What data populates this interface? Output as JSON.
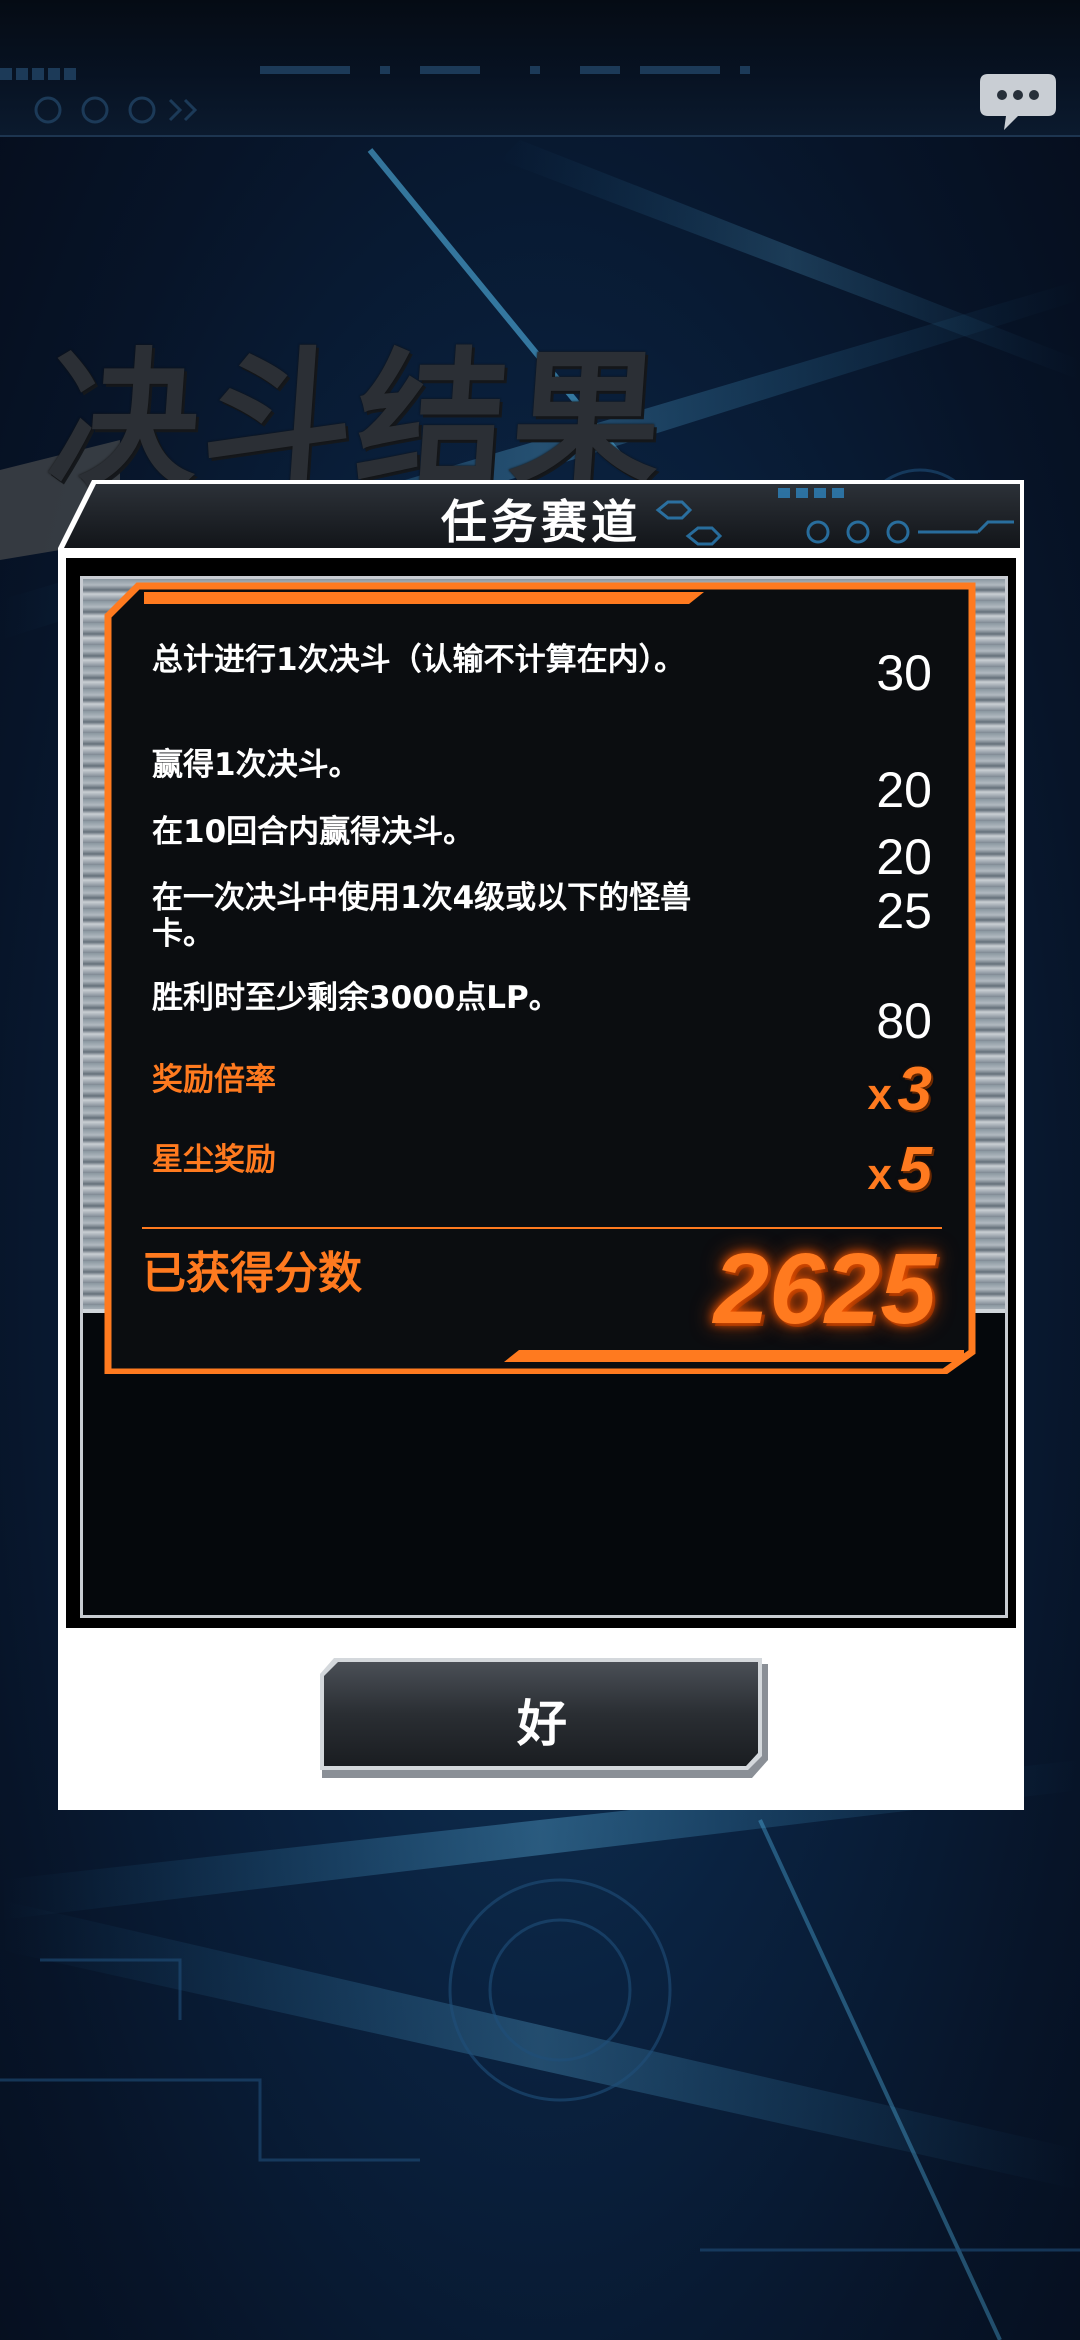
{
  "background": {
    "title": "决斗结果"
  },
  "dialog": {
    "title": "任务赛道",
    "missions": [
      {
        "label": "总计进行1次决斗（认输不计算在内）。",
        "value": "30"
      },
      {
        "label": "赢得1次决斗。",
        "value": "20"
      },
      {
        "label": "在10回合内赢得决斗。",
        "value": "20"
      },
      {
        "label": "在一次决斗中使用1次4级或以下的怪兽卡。",
        "value": "25"
      },
      {
        "label": "胜利时至少剩余3000点LP。",
        "value": "80"
      }
    ],
    "bonuses": [
      {
        "label": "奖励倍率",
        "prefix": "x",
        "value": "3"
      },
      {
        "label": "星尘奖励",
        "prefix": "x",
        "value": "5"
      }
    ],
    "score_label": "已获得分数",
    "score_value": "2625",
    "ok_label": "好"
  },
  "icons": {
    "chat": "chat-bubble-icon"
  },
  "colors": {
    "accent": "#ff7a1f",
    "panel_bg": "#0b0d10",
    "dialog_bg": "#ffffff",
    "text": "#ffffff"
  }
}
